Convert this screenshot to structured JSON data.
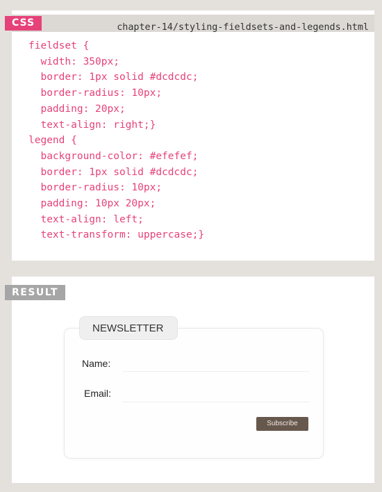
{
  "css": {
    "tag": "CSS",
    "file_path": "chapter-14/styling-fieldsets-and-legends.html",
    "code": "fieldset {\n  width: 350px;\n  border: 1px solid #dcdcdc;\n  border-radius: 10px;\n  padding: 20px;\n  text-align: right;}\nlegend {\n  background-color: #efefef;\n  border: 1px solid #dcdcdc;\n  border-radius: 10px;\n  padding: 10px 20px;\n  text-align: left;\n  text-transform: uppercase;}"
  },
  "result": {
    "tag": "RESULT",
    "legend": "NEWSLETTER",
    "name_label": "Name:",
    "email_label": "Email:",
    "button_label": "Subscribe"
  },
  "colors": {
    "accent_pink": "#e6427a",
    "result_tag_gray": "#a7a6a6",
    "page_background": "#e4e1dd",
    "button_brown": "#67584e"
  }
}
